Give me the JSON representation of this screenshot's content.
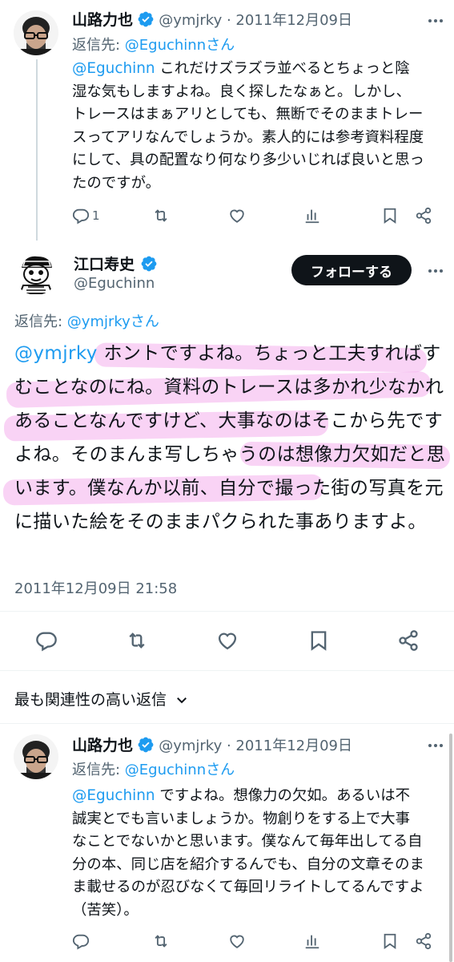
{
  "reply1": {
    "name": "山路力也",
    "handle_date": "@ymjrky · 2011年12月09日",
    "reply_prefix": "返信先: ",
    "reply_target": "@Eguchinnさん",
    "mention": "@Eguchinn",
    "text": " これだけズラズラ並べるとちょっと陰湿な気もしますよね。良く探したなぁと。しかし、トレースはまぁアリとしても、無断でそのままトレースってアリなんでしょうか。素人的には参考資料程度にして、具の配置なり何なり多少いじれば良いと思ったのですが。",
    "reply_count": "1"
  },
  "main": {
    "name": "江口寿史",
    "handle": "@Eguchinn",
    "follow_label": "フォローする",
    "reply_prefix": "返信先: ",
    "reply_target": "@ymjrkyさん",
    "mention": "@ymjrky",
    "text": " ホントですよね。ちょっと工夫すればすむことなのにね。資料のトレースは多かれ少なかれあることなんですけど、大事なのはそこから先ですよね。そのまんま写しちゃうのは想像力欠如だと思います。僕なんか以前、自分で撮った街の写真を元に描いた絵をそのままパクられた事ありますよ。",
    "timestamp": "2011年12月09日 21:58"
  },
  "sort": {
    "label": "最も関連性の高い返信"
  },
  "reply2": {
    "name": "山路力也",
    "handle_date": "@ymjrky · 2011年12月09日",
    "reply_prefix": "返信先: ",
    "reply_target": "@Eguchinnさん",
    "mention": "@Eguchinn",
    "text": " ですよね。想像力の欠如。あるいは不誠実とでも言いましょうか。物創りをする上で大事なことでないかと思います。僕なんて毎年出してる自分の本、同じ店を紹介するんでも、自分の文章そのまま載せるのが忍びなくて毎回リライトしてるんですよ（苦笑）。"
  },
  "colors": {
    "accent": "#1d9bf0",
    "text": "#0f1419",
    "muted": "#536471",
    "highlight": "#f08ce6"
  },
  "icons": [
    "reply-icon",
    "retweet-icon",
    "like-icon",
    "views-icon",
    "bookmark-icon",
    "share-icon",
    "more-icon",
    "verified-icon",
    "chevron-down-icon"
  ]
}
